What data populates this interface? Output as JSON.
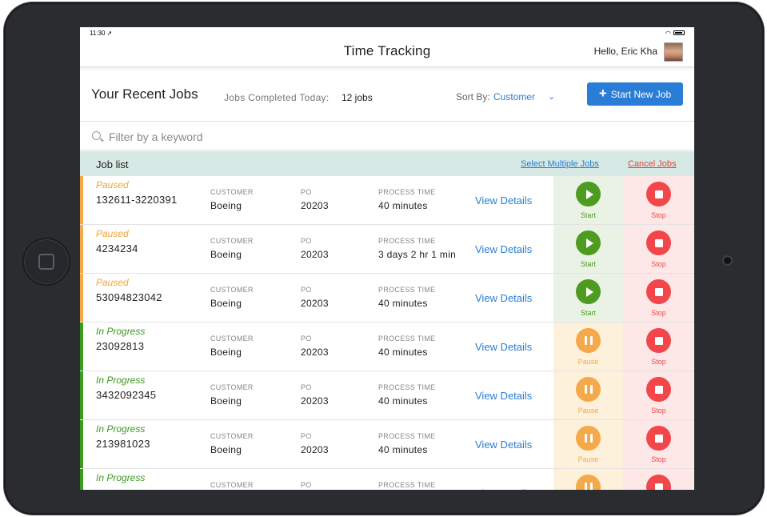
{
  "status_bar": {
    "time": "11:30",
    "location_icon": "location-arrow-icon"
  },
  "nav": {
    "title": "Time Tracking",
    "greeting": "Hello, Eric Kha"
  },
  "jobs_header": {
    "title": "Your Recent Jobs",
    "completed_label": "Jobs Completed Today:",
    "completed_value": "12 jobs",
    "sort_label": "Sort By:",
    "sort_value": "Customer",
    "start_button": "Start New Job"
  },
  "filter": {
    "placeholder": "Filter by a keyword",
    "value": ""
  },
  "list": {
    "title": "Job list",
    "select_multiple": "Select Multiple Jobs",
    "cancel_jobs": "Cancel Jobs"
  },
  "columns": {
    "customer": "CUSTOMER",
    "po": "PO",
    "process_time": "PROCESS TIME",
    "view_details": "View Details",
    "start": "Start",
    "pause": "Pause",
    "stop": "Stop"
  },
  "colors": {
    "paused": "#f4a94a",
    "paused_text": "#f0a437",
    "in_progress": "#3a9a1c",
    "in_progress_text": "#3a9a1c",
    "accent": "#2a7dd6",
    "start_green": "#4e9b22",
    "stop_red": "#f2464b",
    "start_cell": "#e9f2e4",
    "pause_cell": "#fdf1dc",
    "stop_cell": "#fde7e7"
  },
  "jobs": [
    {
      "status": "Paused",
      "job_id": "132611-3220391",
      "customer": "Boeing",
      "po": "20203",
      "process_time": "40 minutes",
      "action": "Start"
    },
    {
      "status": "Paused",
      "job_id": "4234234",
      "customer": "Boeing",
      "po": "20203",
      "process_time": "3 days 2 hr 1 min",
      "action": "Start"
    },
    {
      "status": "Paused",
      "job_id": "53094823042",
      "customer": "Boeing",
      "po": "20203",
      "process_time": "40 minutes",
      "action": "Start"
    },
    {
      "status": "In Progress",
      "job_id": "23092813",
      "customer": "Boeing",
      "po": "20203",
      "process_time": "40 minutes",
      "action": "Pause"
    },
    {
      "status": "In Progress",
      "job_id": "3432092345",
      "customer": "Boeing",
      "po": "20203",
      "process_time": "40 minutes",
      "action": "Pause"
    },
    {
      "status": "In Progress",
      "job_id": "213981023",
      "customer": "Boeing",
      "po": "20203",
      "process_time": "40 minutes",
      "action": "Pause"
    },
    {
      "status": "In Progress",
      "job_id": "",
      "customer": "",
      "po": "",
      "process_time": "",
      "action": "Pause"
    }
  ]
}
